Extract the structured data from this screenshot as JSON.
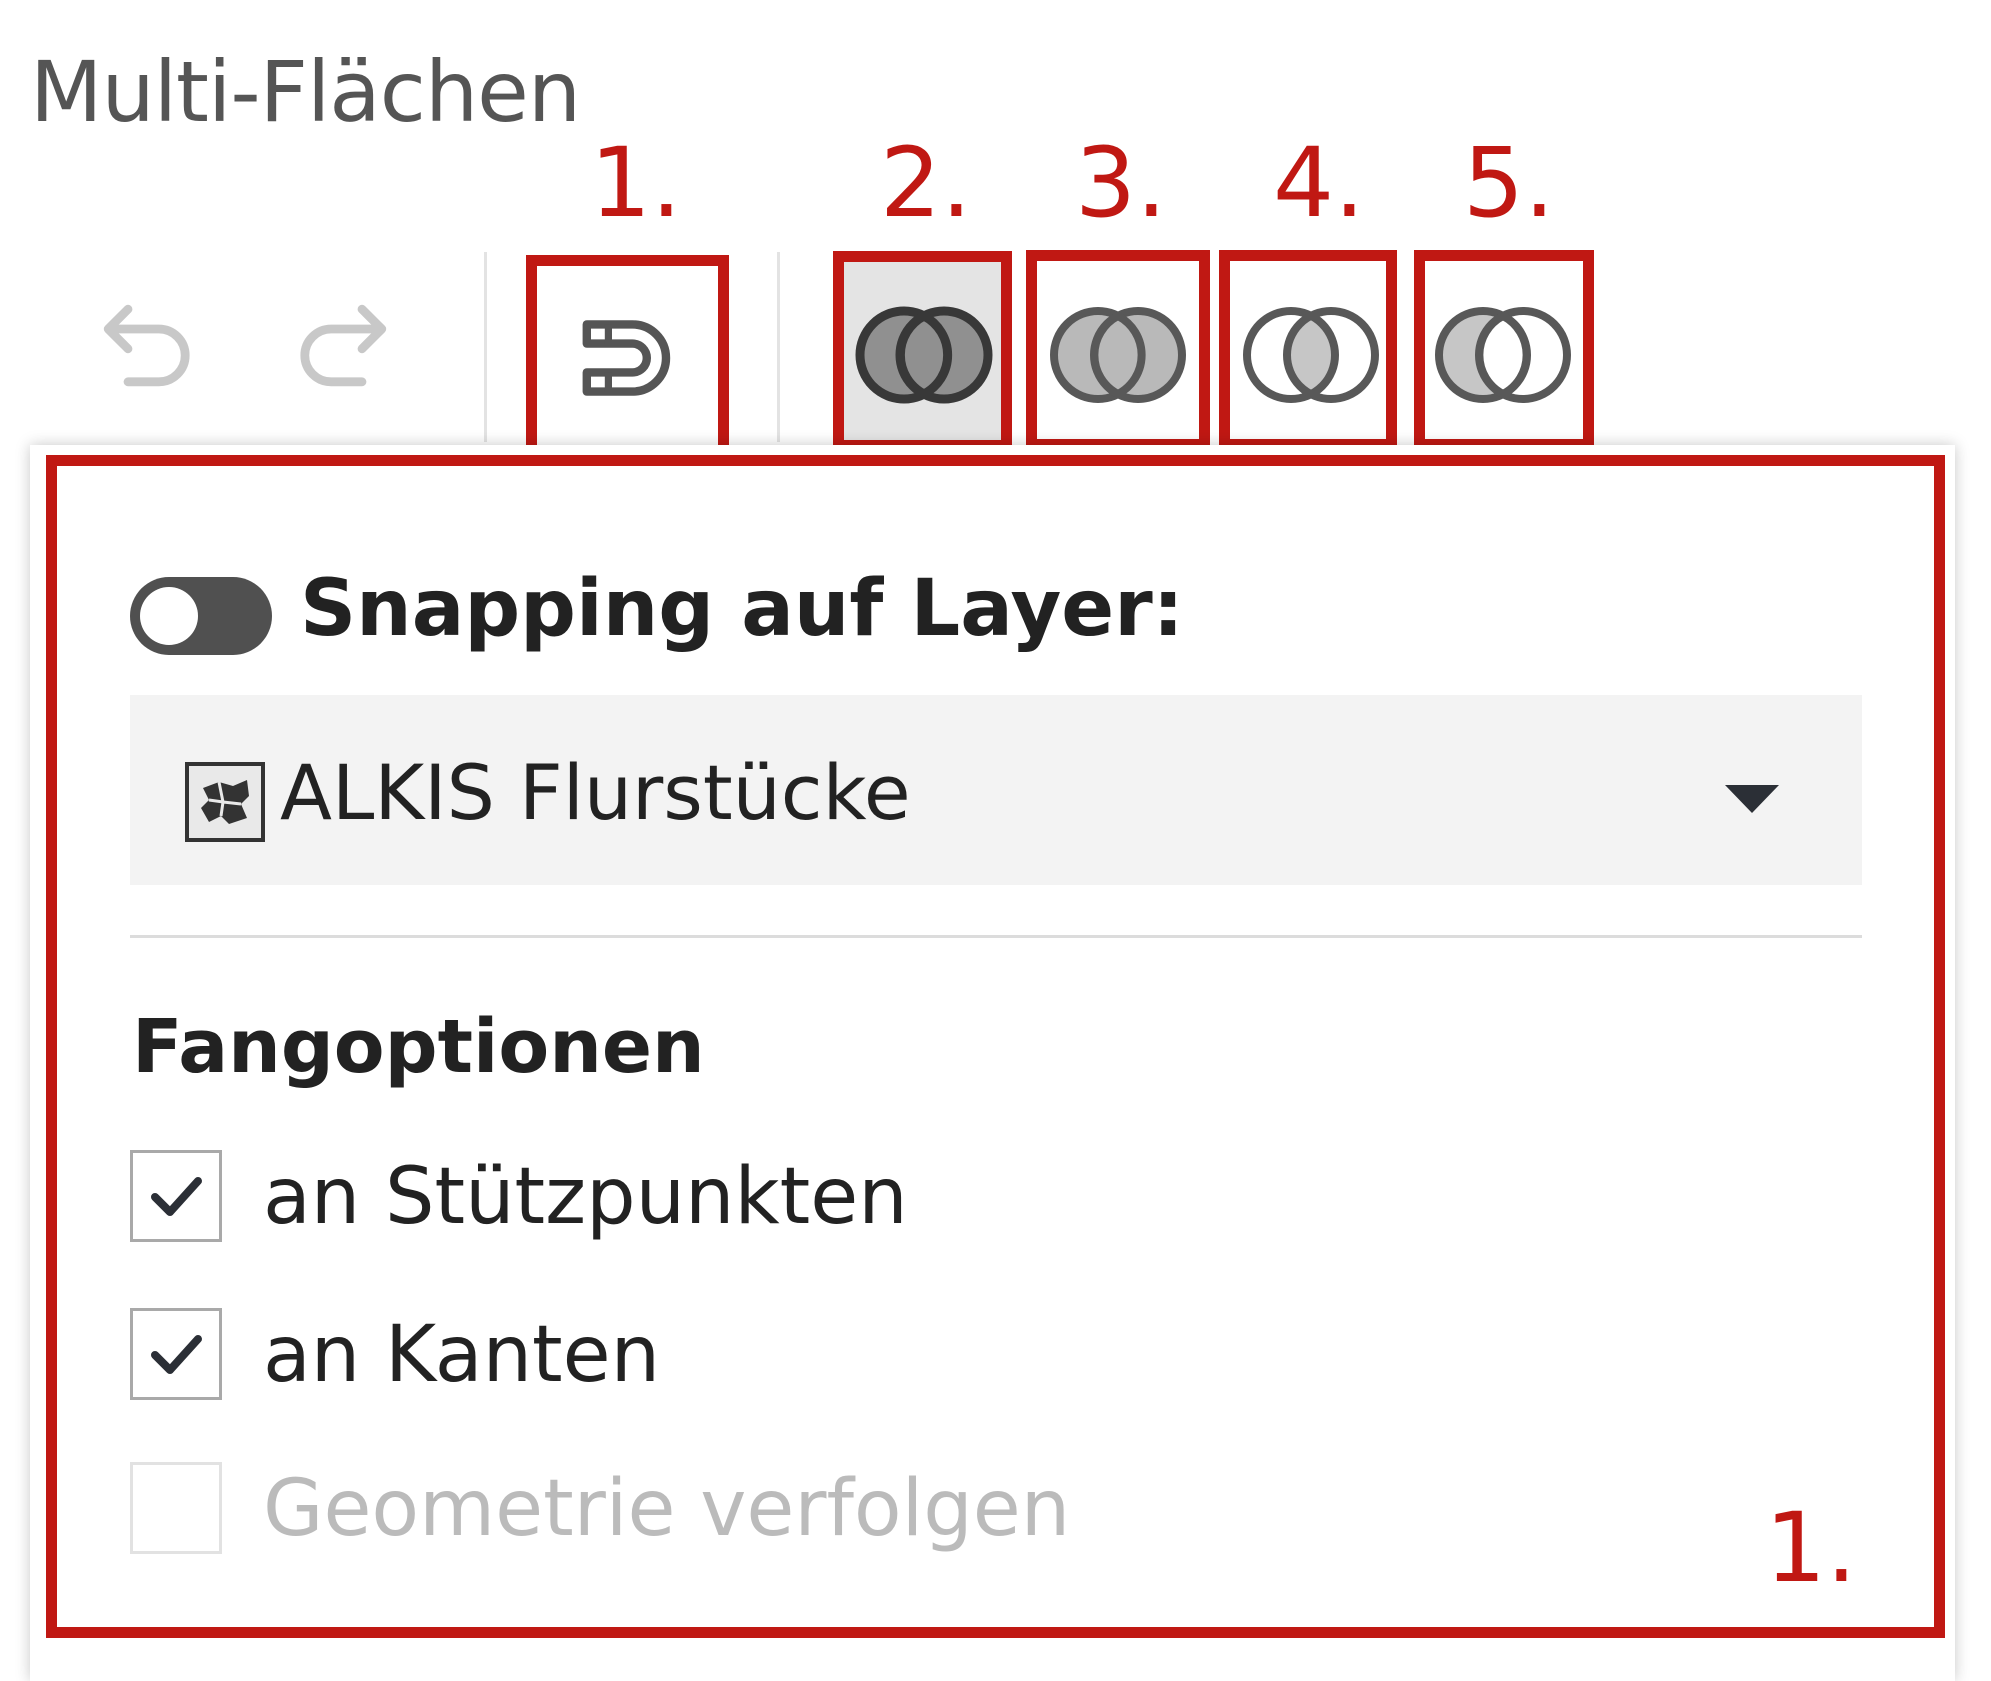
{
  "header": {
    "title": "Multi-Flächen"
  },
  "toolbar": {
    "undo_icon": "undo-icon",
    "redo_icon": "redo-icon",
    "snap_icon": "magnet-icon",
    "bool_icons": [
      "union-icon",
      "difference-icon",
      "intersection-icon",
      "xor-icon"
    ]
  },
  "annotations": {
    "snap": "1.",
    "union": "2.",
    "difference": "3.",
    "intersection": "4.",
    "xor": "5.",
    "panel": "1."
  },
  "snapping": {
    "toggle_label": "Snapping auf Layer:",
    "toggle_on": false,
    "layer_select": {
      "value": "ALKIS Flurstücke",
      "icon": "map-layer-icon"
    }
  },
  "fang": {
    "heading": "Fangoptionen",
    "options": [
      {
        "label": "an Stützpunkten",
        "checked": true,
        "disabled": false
      },
      {
        "label": "an Kanten",
        "checked": true,
        "disabled": false
      },
      {
        "label": "Geometrie verfolgen",
        "checked": false,
        "disabled": true
      }
    ]
  },
  "colors": {
    "annotation_red": "#c01813",
    "toggle_track": "#505050",
    "select_bg": "#f3f3f3"
  }
}
